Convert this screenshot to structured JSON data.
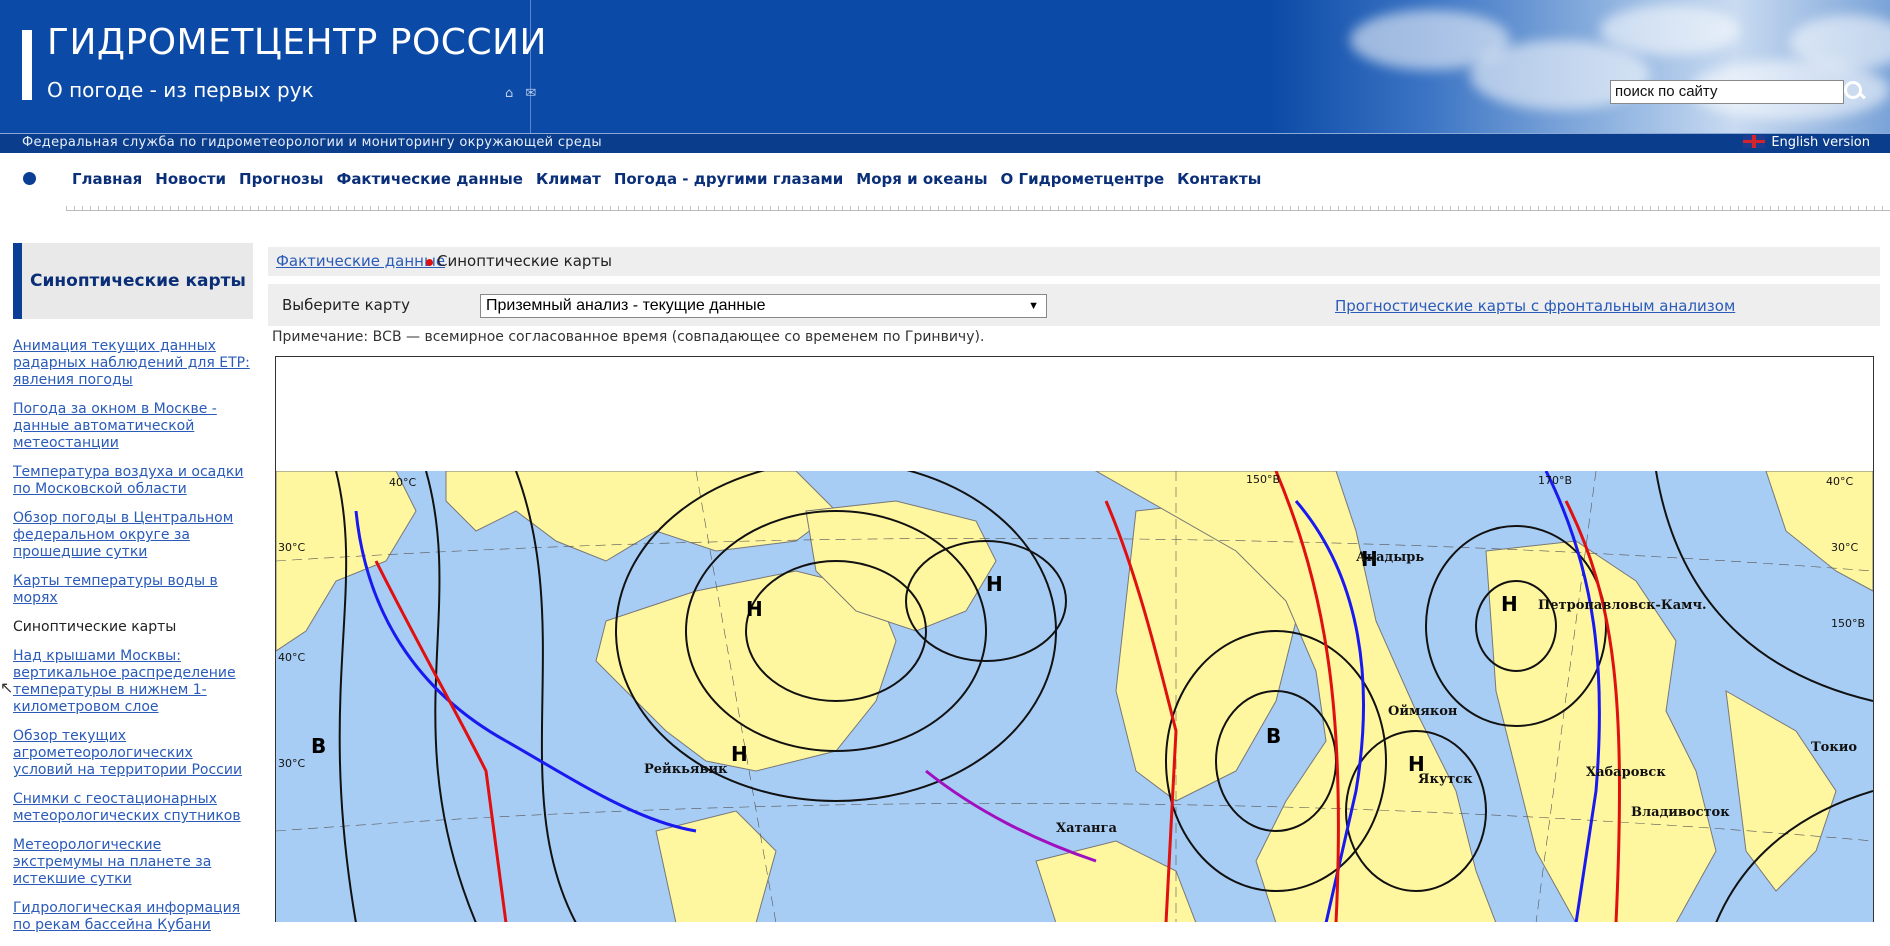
{
  "header": {
    "title": "ГИДРОМЕТЦЕНТР РОССИИ",
    "subtitle": "О погоде - из первых рук",
    "search_placeholder": "поиск по сайту",
    "federal_service": "Федеральная служба по гидрометеорологии и мониторингу окружающей среды",
    "english_version": "English version"
  },
  "nav": {
    "items": [
      "Главная",
      "Новости",
      "Прогнозы",
      "Фактические данные",
      "Климат",
      "Погода - другими глазами",
      "Моря и океаны",
      "О Гидрометцентре",
      "Контакты"
    ]
  },
  "sidebar": {
    "title": "Синоптические карты",
    "links": [
      "Анимация текущих данных радарных наблюдений для ЕТР: явления погоды",
      "Погода за окном в Москве - данные автоматической метеостанции",
      "Температура воздуха и осадки по Московской области",
      "Обзор погоды в Центральном федеральном округе за прошедшие сутки",
      "Карты температуры воды в морях",
      "Синоптические карты",
      "Над крышами Москвы: вертикальное распределение температуры в нижнем 1-километровом слое",
      "Обзор текущих агрометеорологических условий на территории России",
      "Снимки с геостационарных метеорологических спутников",
      "Метеорологические экстремумы на планете за истекшие сутки",
      "Гидрологическая информация по рекам бассейна Кубани"
    ]
  },
  "breadcrumb": {
    "parent": "Фактические данные",
    "current": "Синоптические карты"
  },
  "selector": {
    "label": "Выберите карту",
    "selected": "Приземный анализ - текущие данные",
    "forecast_link": "Прогностические карты с фронтальным анализом"
  },
  "note": "Примечание: ВСВ — всемирное согласованное время (совпадающее со временем по Гринвичу).",
  "map": {
    "place_labels": [
      "Анадырь",
      "Петропавловск-Камч.",
      "Оймякон",
      "Якутск",
      "Хабаровск",
      "Владивосток",
      "Токио",
      "Хатанга",
      "Рейкьявик"
    ],
    "pressure_centers": [
      "Н",
      "Н",
      "Н",
      "Н",
      "Н",
      "Н",
      "Н",
      "В",
      "В"
    ],
    "lat_labels": [
      "40°С",
      "150°В",
      "170°В",
      "40°С",
      "30°С",
      "30°С",
      "150°В",
      "40°С",
      "30°С"
    ]
  }
}
